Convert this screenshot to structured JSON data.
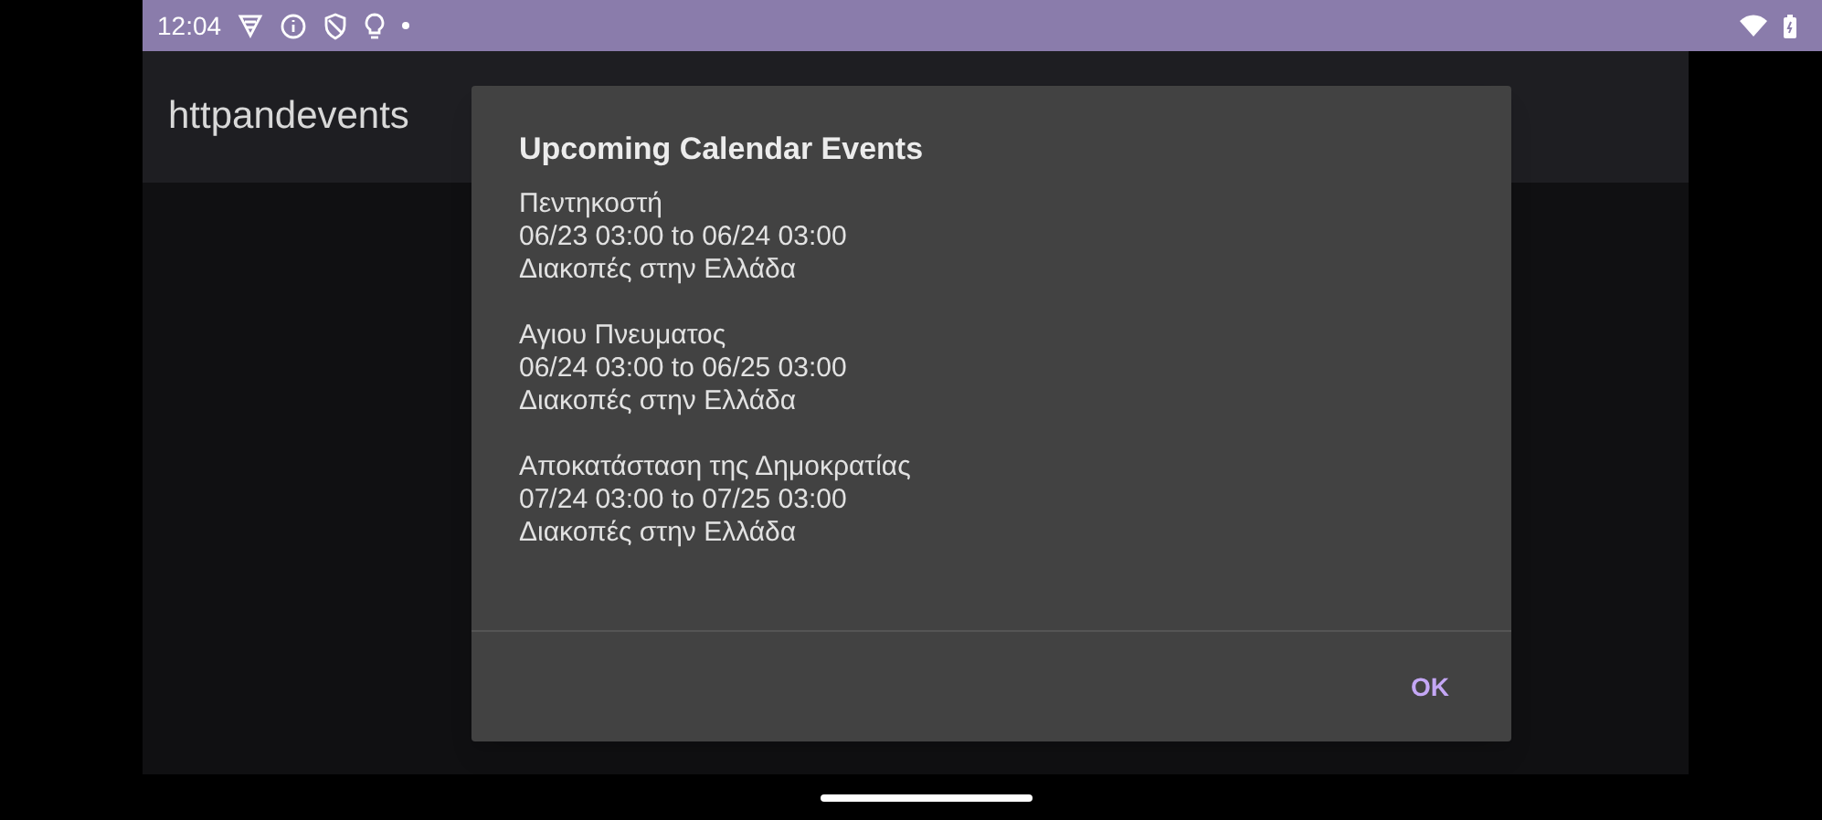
{
  "status_bar": {
    "time": "12:04"
  },
  "app_bar": {
    "title": "httpandevents"
  },
  "dialog": {
    "title": "Upcoming Calendar Events",
    "events": [
      {
        "name": "Πεντηκοστή",
        "time": "06/23 03:00 to 06/24 03:00",
        "calendar": "Διακοπές στην Ελλάδα"
      },
      {
        "name": "Αγιου Πνευματος",
        "time": "06/24 03:00 to 06/25 03:00",
        "calendar": "Διακοπές στην Ελλάδα"
      },
      {
        "name": "Αποκατάσταση της Δημοκρατίας",
        "time": "07/24 03:00 to 07/25 03:00",
        "calendar": "Διακοπές στην Ελλάδα"
      }
    ],
    "buttons": [
      "OK"
    ]
  }
}
